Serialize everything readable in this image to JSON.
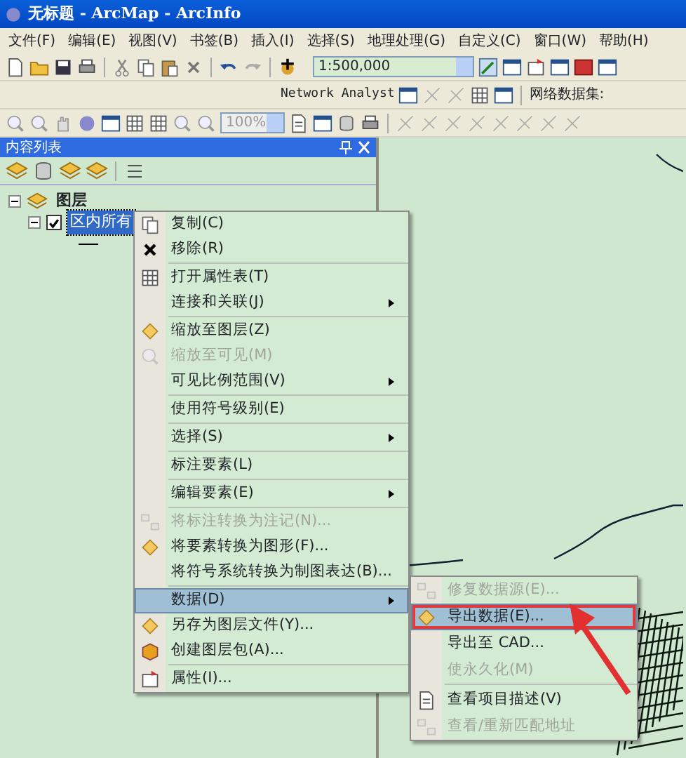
{
  "window": {
    "title": "无标题 - ArcMap - ArcInfo"
  },
  "menu_bar": [
    "文件(F)",
    "编辑(E)",
    "视图(V)",
    "书签(B)",
    "插入(I)",
    "选择(S)",
    "地理处理(G)",
    "自定义(C)",
    "窗口(W)",
    "帮助(H)"
  ],
  "standard_toolbar": {
    "scale": "1:500,000"
  },
  "network_toolbar": {
    "label": "Network Analyst",
    "dataset_label": "网络数据集:"
  },
  "tools_toolbar": {
    "zoom": "100%"
  },
  "toc": {
    "title": "内容列表",
    "root": {
      "label": "图层",
      "expanded": true,
      "children": [
        {
          "label": "区内所有",
          "checked": true,
          "selected": true,
          "expanded": true
        }
      ]
    }
  },
  "context_menu": {
    "items": [
      {
        "kind": "item",
        "label": "复制(C)",
        "disabled": false,
        "submenu": false,
        "selected": false
      },
      {
        "kind": "item",
        "label": "移除(R)",
        "disabled": false,
        "submenu": false,
        "selected": false
      },
      {
        "kind": "separator"
      },
      {
        "kind": "item",
        "label": "打开属性表(T)",
        "disabled": false,
        "submenu": false,
        "selected": false
      },
      {
        "kind": "item",
        "label": "连接和关联(J)",
        "disabled": false,
        "submenu": true,
        "selected": false
      },
      {
        "kind": "separator"
      },
      {
        "kind": "item",
        "label": "缩放至图层(Z)",
        "disabled": false,
        "submenu": false,
        "selected": false
      },
      {
        "kind": "item",
        "label": "缩放至可见(M)",
        "disabled": true,
        "submenu": false,
        "selected": false
      },
      {
        "kind": "item",
        "label": "可见比例范围(V)",
        "disabled": false,
        "submenu": true,
        "selected": false
      },
      {
        "kind": "separator"
      },
      {
        "kind": "item",
        "label": "使用符号级别(E)",
        "disabled": false,
        "submenu": false,
        "selected": false
      },
      {
        "kind": "separator"
      },
      {
        "kind": "item",
        "label": "选择(S)",
        "disabled": false,
        "submenu": true,
        "selected": false
      },
      {
        "kind": "separator"
      },
      {
        "kind": "item",
        "label": "标注要素(L)",
        "disabled": false,
        "submenu": false,
        "selected": false
      },
      {
        "kind": "separator"
      },
      {
        "kind": "item",
        "label": "编辑要素(E)",
        "disabled": false,
        "submenu": true,
        "selected": false
      },
      {
        "kind": "separator"
      },
      {
        "kind": "item",
        "label": "将标注转换为注记(N)...",
        "disabled": true,
        "submenu": false,
        "selected": false
      },
      {
        "kind": "item",
        "label": "将要素转换为图形(F)...",
        "disabled": false,
        "submenu": false,
        "selected": false
      },
      {
        "kind": "item",
        "label": "将符号系统转换为制图表达(B)...",
        "disabled": false,
        "submenu": false,
        "selected": false
      },
      {
        "kind": "separator"
      },
      {
        "kind": "item",
        "label": "数据(D)",
        "disabled": false,
        "submenu": true,
        "selected": true
      },
      {
        "kind": "item",
        "label": "另存为图层文件(Y)...",
        "disabled": false,
        "submenu": false,
        "selected": false
      },
      {
        "kind": "item",
        "label": "创建图层包(A)...",
        "disabled": false,
        "submenu": false,
        "selected": false
      },
      {
        "kind": "separator"
      },
      {
        "kind": "item",
        "label": "属性(I)...",
        "disabled": false,
        "submenu": false,
        "selected": false
      }
    ]
  },
  "submenu": {
    "items": [
      {
        "kind": "item",
        "label": "修复数据源(E)...",
        "disabled": true,
        "selected": false,
        "outlined": false
      },
      {
        "kind": "item",
        "label": "导出数据(E)...",
        "disabled": false,
        "selected": true,
        "outlined": true
      },
      {
        "kind": "item",
        "label": "导出至 CAD...",
        "disabled": false,
        "selected": false,
        "outlined": false
      },
      {
        "kind": "item",
        "label": "使永久化(M)",
        "disabled": true,
        "selected": false,
        "outlined": false
      },
      {
        "kind": "separator"
      },
      {
        "kind": "item",
        "label": "查看项目描述(V)",
        "disabled": false,
        "selected": false,
        "outlined": false
      },
      {
        "kind": "item",
        "label": "查看/重新匹配地址",
        "disabled": true,
        "selected": false,
        "outlined": false
      }
    ]
  }
}
